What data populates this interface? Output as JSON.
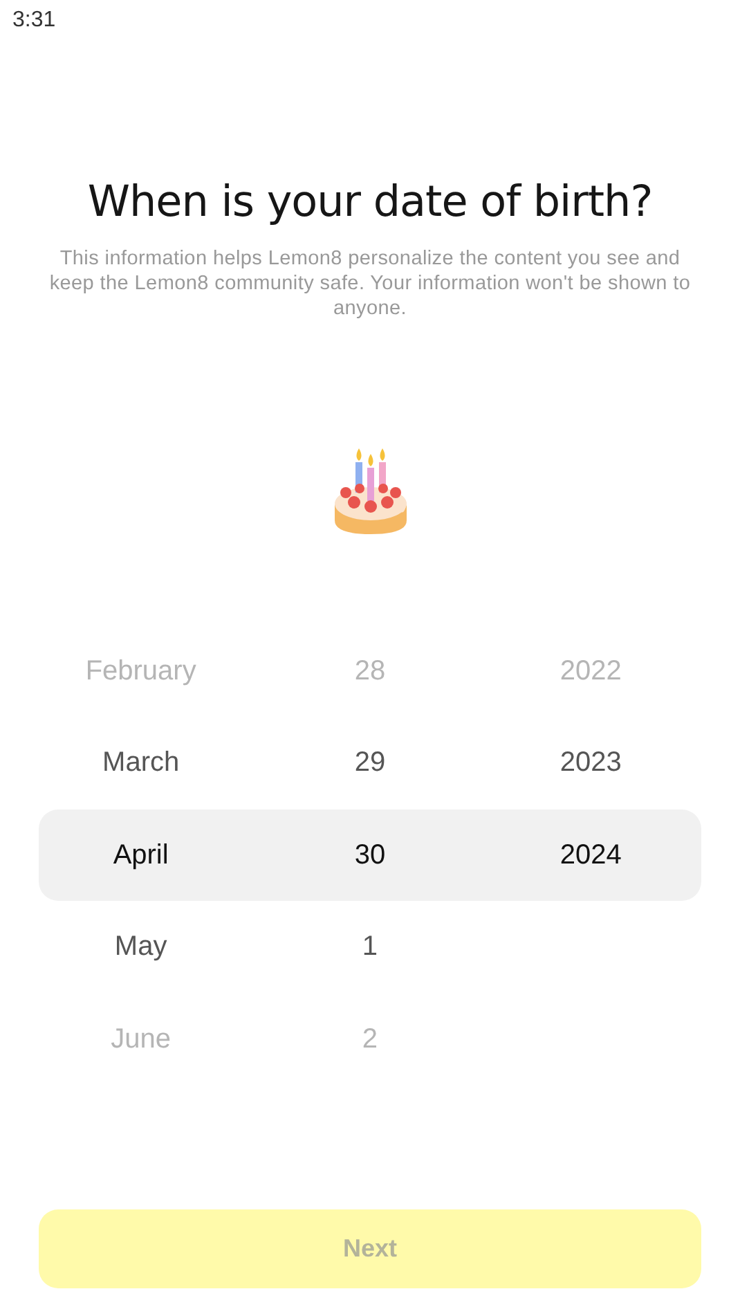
{
  "status_bar": {
    "time": "3:31"
  },
  "title": "When is your date of birth?",
  "description": "This information helps Lemon8 personalize the content you see and keep the Lemon8 community safe. Your information won't be shown to anyone.",
  "picker": {
    "columns": [
      {
        "kind": "month",
        "items": [
          {
            "label": "February",
            "selected": false
          },
          {
            "label": "March",
            "selected": false
          },
          {
            "label": "April",
            "selected": true
          },
          {
            "label": "May",
            "selected": false
          },
          {
            "label": "June",
            "selected": false
          }
        ]
      },
      {
        "kind": "day",
        "items": [
          {
            "label": "28",
            "selected": false
          },
          {
            "label": "29",
            "selected": false
          },
          {
            "label": "30",
            "selected": true
          },
          {
            "label": "1",
            "selected": false
          },
          {
            "label": "2",
            "selected": false
          }
        ]
      },
      {
        "kind": "year",
        "items": [
          {
            "label": "2022",
            "selected": false
          },
          {
            "label": "2023",
            "selected": false
          },
          {
            "label": "2024",
            "selected": true
          }
        ]
      }
    ]
  },
  "next_button": {
    "label": "Next",
    "disabled": true
  }
}
